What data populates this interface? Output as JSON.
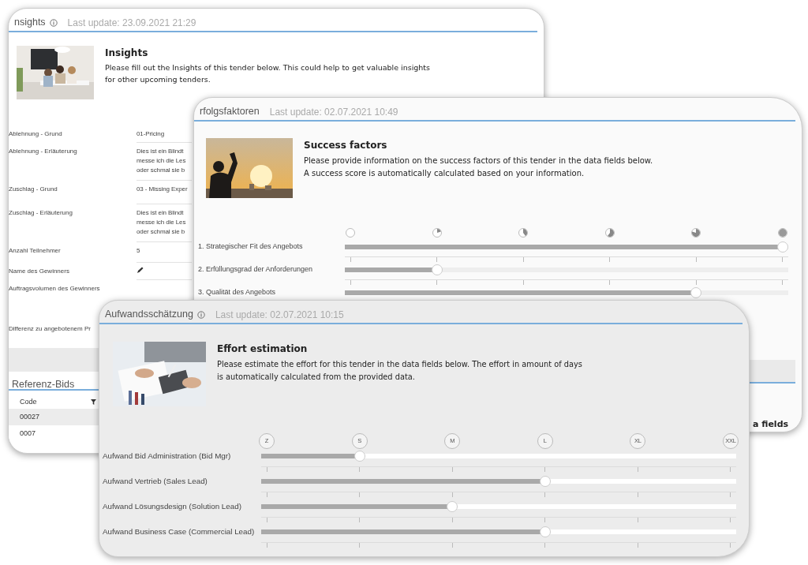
{
  "insights_panel": {
    "title": "nsights",
    "last_update": "Last update: 23.09.2021 21:29",
    "intro": {
      "heading": "Insights",
      "text": "Please fill out the Insights of this tender below. This could help to get valuable insights for other upcoming tenders."
    },
    "fields": [
      {
        "kind": "text",
        "label": "Ablehnung - Grund",
        "value": "01-Pricing"
      },
      {
        "kind": "multiline",
        "label": "Ablehnung - Erläuterung",
        "lines": [
          "Dies ist ein Blindt",
          "messe ich die Les",
          "oder schmal sie b"
        ]
      },
      {
        "kind": "text",
        "label": "Zuschlag - Grund",
        "value": "03 - Missing Exper"
      },
      {
        "kind": "multiline",
        "label": "Zuschlag - Erläuterung",
        "lines": [
          "Dies ist ein Blindt",
          "messe ich die Les",
          "oder schmal sie b"
        ]
      },
      {
        "kind": "text",
        "label": "Anzahl Teilnehmer",
        "value": "5"
      },
      {
        "kind": "edit",
        "label": "Name des Gewinners"
      },
      {
        "kind": "plain",
        "label": "Auftragsvolumen des Gewinners"
      },
      {
        "kind": "plain",
        "label": "Differenz zu angebotenem Pr"
      }
    ],
    "reference_section": {
      "title": "Referenz-Bids",
      "columns": [
        "Code"
      ],
      "rows": [
        [
          "00027"
        ],
        [
          "0007"
        ]
      ]
    }
  },
  "success_panel": {
    "title": "rfolgsfaktoren",
    "last_update": "Last update: 02.07.2021 10:49",
    "intro": {
      "heading": "Success factors",
      "text": "Please provide information on the success factors of this tender in the data fields below. A success score is automatically calculated based on your information."
    },
    "sliders": [
      {
        "label": "1. Strategischer Fit des Angebots",
        "level": 1.0
      },
      {
        "label": "2. Erfüllungsgrad der Anforderungen",
        "level": 0.2
      },
      {
        "label": "3. Qualität des Angebots",
        "level": 0.8
      }
    ],
    "trailing_text": "a fields"
  },
  "effort_panel": {
    "title": "Aufwandsschätzung",
    "last_update": "Last update: 02.07.2021 10:15",
    "intro": {
      "heading": "Effort estimation",
      "text": "Please estimate the effort for this tender in the data fields below. The effort in amount of days is automatically calculated from the provided data."
    },
    "scale": [
      "Z",
      "S",
      "M",
      "L",
      "XL",
      "XXL"
    ],
    "sliders": [
      {
        "label": "Aufwand Bid Administration (Bid Mgr)",
        "level": 0.2
      },
      {
        "label": "Aufwand Vertrieb (Sales Lead)",
        "level": 0.6
      },
      {
        "label": "Aufwand Lösungsdesign (Solution Lead)",
        "level": 0.4
      },
      {
        "label": "Aufwand Business Case (Commercial Lead)",
        "level": 0.6
      }
    ]
  }
}
